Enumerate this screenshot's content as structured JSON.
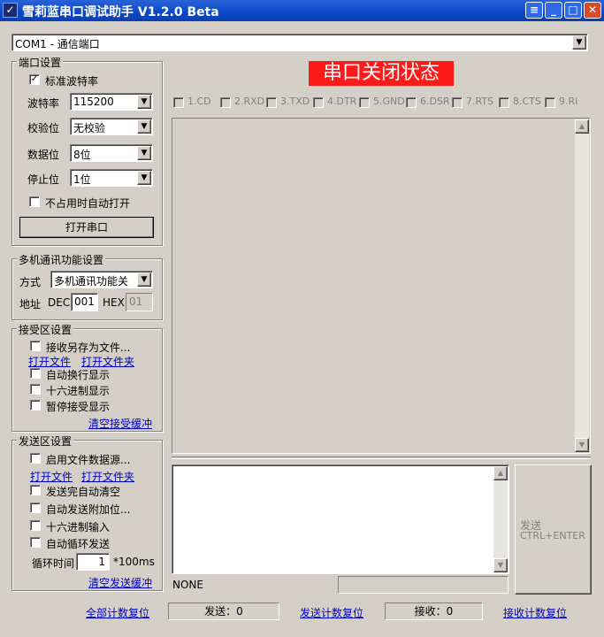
{
  "window": {
    "title": "雪莉蓝串口调试助手  V1.2.0 Beta",
    "app_icon": "app-icon"
  },
  "port_select": {
    "value": "COM1 - 通信端口"
  },
  "port_settings": {
    "legend": "端口设置",
    "standard_baud": {
      "label": "标准波特率",
      "checked": true
    },
    "baud": {
      "label": "波特率",
      "value": "115200"
    },
    "parity": {
      "label": "校验位",
      "value": "无校验"
    },
    "databits": {
      "label": "数据位",
      "value": "8位"
    },
    "stopbits": {
      "label": "停止位",
      "value": "1位"
    },
    "auto_open": {
      "label": "不占用时自动打开",
      "checked": false
    },
    "open_button": "打开串口"
  },
  "multi": {
    "legend": "多机通讯功能设置",
    "mode_label": "方式",
    "mode_value": "多机通讯功能关",
    "addr_label": "地址",
    "dec_label": "DEC",
    "dec_value": "001",
    "hex_label": "HEX",
    "hex_value": "01"
  },
  "receive": {
    "legend": "接受区设置",
    "save_file": "接收另存为文件...",
    "open_file": "打开文件",
    "open_folder": "打开文件夹",
    "auto_newline": "自动换行显示",
    "hex_display": "十六进制显示",
    "pause": "暂停接受显示",
    "clear": "清空接受缓冲"
  },
  "send": {
    "legend": "发送区设置",
    "file_source": "启用文件数据源...",
    "open_file": "打开文件",
    "open_folder": "打开文件夹",
    "auto_clear": "发送完自动清空",
    "append": "自动发送附加位...",
    "hex_input": "十六进制输入",
    "loop": "自动循环发送",
    "cycle_label": "循环时间",
    "cycle_value": "1",
    "cycle_unit": "*100ms",
    "clear": "清空发送缓冲"
  },
  "status_banner": {
    "text": "串口关闭状态",
    "color": "#ff1a1a"
  },
  "signals": [
    "1.CD",
    "2.RXD",
    "3.TXD",
    "4.DTR",
    "5.GND",
    "6.DSR",
    "7.RTS",
    "8.CTS",
    "9.RI"
  ],
  "send_button": {
    "line1": "发送",
    "line2": "CTRL+ENTER"
  },
  "status": {
    "mode": "NONE"
  },
  "footer": {
    "reset_all": "全部计数复位",
    "sent": "发送：0",
    "reset_sent": "发送计数复位",
    "received": "接收：0",
    "reset_received": "接收计数复位"
  }
}
